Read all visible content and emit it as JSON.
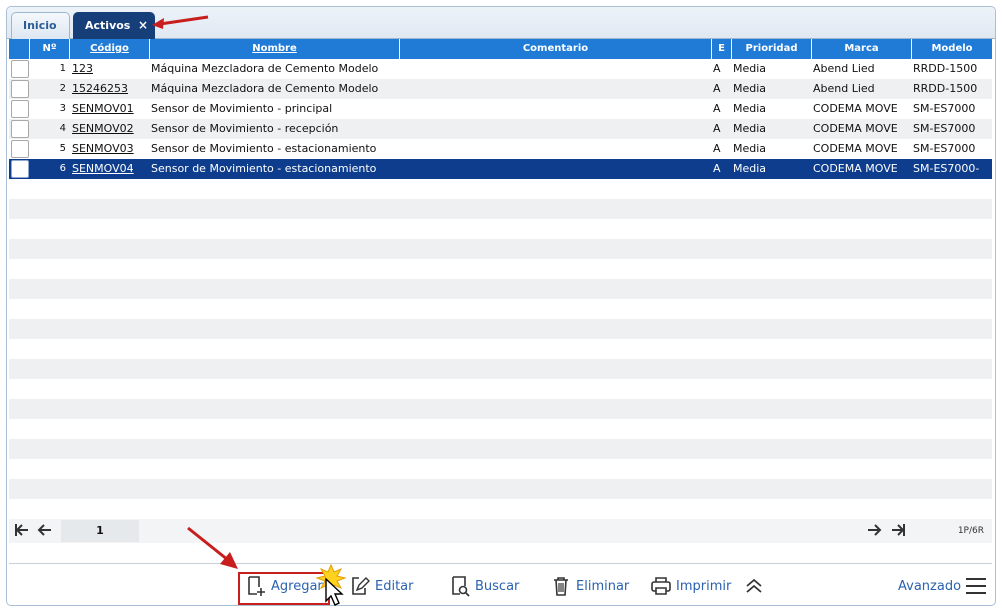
{
  "tabs": {
    "inicio": "Inicio",
    "activos": "Activos",
    "close_glyph": "×"
  },
  "columns": {
    "check": "",
    "num": "Nº",
    "codigo": "Código",
    "nombre": "Nombre",
    "comentario": "Comentario",
    "e": "E",
    "prioridad": "Prioridad",
    "marca": "Marca",
    "modelo": "Modelo"
  },
  "rows": [
    {
      "num": "1",
      "codigo": "123",
      "nombre": "Máquina Mezcladora de Cemento Modelo",
      "comentario": "",
      "e": "A",
      "prioridad": "Media",
      "marca": "Abend Lied",
      "modelo": "RRDD-1500"
    },
    {
      "num": "2",
      "codigo": "15246253",
      "nombre": "Máquina Mezcladora de Cemento Modelo",
      "comentario": "",
      "e": "A",
      "prioridad": "Media",
      "marca": "Abend Lied",
      "modelo": "RRDD-1500"
    },
    {
      "num": "3",
      "codigo": "SENMOV01",
      "nombre": "Sensor de Movimiento - principal",
      "comentario": "",
      "e": "A",
      "prioridad": "Media",
      "marca": "CODEMA MOVE",
      "modelo": "SM-ES7000"
    },
    {
      "num": "4",
      "codigo": "SENMOV02",
      "nombre": "Sensor de Movimiento - recepción",
      "comentario": "",
      "e": "A",
      "prioridad": "Media",
      "marca": "CODEMA MOVE",
      "modelo": "SM-ES7000"
    },
    {
      "num": "5",
      "codigo": "SENMOV03",
      "nombre": "Sensor de Movimiento - estacionamiento",
      "comentario": "",
      "e": "A",
      "prioridad": "Media",
      "marca": "CODEMA MOVE",
      "modelo": "SM-ES7000"
    },
    {
      "num": "6",
      "codigo": "SENMOV04",
      "nombre": "Sensor de Movimiento - estacionamiento",
      "comentario": "",
      "e": "A",
      "prioridad": "Media",
      "marca": "CODEMA MOVE",
      "modelo": "SM-ES7000-"
    }
  ],
  "selected_row": 6,
  "pager": {
    "page": "1",
    "info": "1P/6R"
  },
  "toolbar": {
    "agregar": "Agregar",
    "editar": "Editar",
    "buscar": "Buscar",
    "eliminar": "Eliminar",
    "imprimir": "Imprimir",
    "avanzado": "Avanzado"
  },
  "icons": {
    "first": "first-page-icon",
    "prev": "prev-page-icon",
    "next": "next-page-icon",
    "last": "last-page-icon",
    "collapse": "chevrons-up-icon",
    "menu": "hamburger-menu-icon"
  },
  "colors": {
    "header": "#1f7bd6",
    "selected": "#0d3d8c",
    "tab_active": "#163f7a",
    "link": "#2a62b0",
    "annotation": "#c81e1e"
  }
}
